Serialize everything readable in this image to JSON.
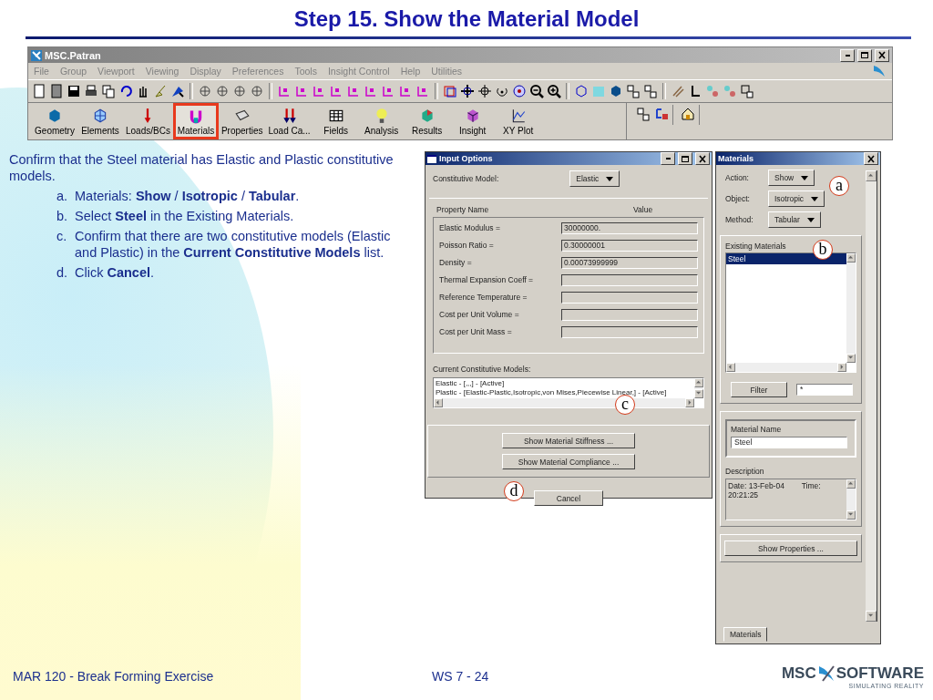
{
  "slide": {
    "title": "Step 15. Show the Material Model",
    "footer_left": "MAR 120 - Break Forming Exercise",
    "footer_center": "WS 7 - 24",
    "logo": {
      "word_1": "MSC",
      "word_2": "SOFTWARE",
      "tagline": "SIMULATING REALITY"
    }
  },
  "patran_window": {
    "title": "MSC.Patran",
    "menu": [
      "File",
      "Group",
      "Viewport",
      "Viewing",
      "Display",
      "Preferences",
      "Tools",
      "Insight Control",
      "Help",
      "Utilities"
    ],
    "apps": [
      {
        "label": "Geometry",
        "selected": false
      },
      {
        "label": "Elements",
        "selected": false
      },
      {
        "label": "Loads/BCs",
        "selected": false
      },
      {
        "label": "Materials",
        "selected": true
      },
      {
        "label": "Properties",
        "selected": false
      },
      {
        "label": "Load Ca...",
        "selected": false
      },
      {
        "label": "Fields",
        "selected": false
      },
      {
        "label": "Analysis",
        "selected": false
      },
      {
        "label": "Results",
        "selected": false
      },
      {
        "label": "Insight",
        "selected": false
      },
      {
        "label": "XY Plot",
        "selected": false
      }
    ]
  },
  "instructions": {
    "intro": "Confirm that the Steel material has Elastic and Plastic constitutive models.",
    "steps": [
      {
        "marker": "a.",
        "text": "Materials: **Show** / **Isotropic** / **Tabular**."
      },
      {
        "marker": "b.",
        "text": "Select **Steel** in the Existing Materials."
      },
      {
        "marker": "c.",
        "text": "Confirm that there are two constitutive models (Elastic and Plastic) in the **Current Constitutive Models** list."
      },
      {
        "marker": "d.",
        "text": "Click **Cancel**."
      }
    ]
  },
  "input_options": {
    "title": "Input Options",
    "constitutive_model_label": "Constitutive Model:",
    "constitutive_model": "Elastic",
    "columns": [
      "Property Name",
      "Value"
    ],
    "properties": [
      {
        "name": "Elastic Modulus =",
        "value": "30000000."
      },
      {
        "name": "Poisson Ratio =",
        "value": "0.30000001"
      },
      {
        "name": "Density =",
        "value": "0.00073999999"
      },
      {
        "name": "Thermal Expansion Coeff ="
      },
      {
        "name": "Reference Temperature ="
      },
      {
        "name": "Cost per Unit Volume ="
      },
      {
        "name": "Cost per Unit Mass ="
      }
    ],
    "current_models_label": "Current Constitutive Models:",
    "current_models": [
      "Elastic - [,,,] - [Active]",
      "Plastic - [Elastic-Plastic,Isotropic,von Mises,Piecewise Linear,] - [Active]"
    ],
    "buttons": [
      "Show Material Stiffness ...",
      "Show Material Compliance ..."
    ],
    "cancel": "Cancel"
  },
  "materials_panel": {
    "title": "Materials",
    "fields": [
      {
        "label": "Action:",
        "value": "Show"
      },
      {
        "label": "Object:",
        "value": "Isotropic"
      },
      {
        "label": "Method:",
        "value": "Tabular"
      }
    ],
    "existing_label": "Existing Materials",
    "materials": [
      {
        "name": "Steel",
        "selected": true
      }
    ],
    "filter_button": "Filter",
    "filter_value": "*",
    "material_name_label": "Material Name",
    "material_name": "Steel",
    "description_label": "Description",
    "description_lines": [
      "Date: 13-Feb-04        Time:",
      "20:21:25"
    ],
    "show_properties": "Show Properties ...",
    "tab": "Materials"
  },
  "callouts": [
    {
      "label": "a"
    },
    {
      "label": "b"
    },
    {
      "label": "c"
    },
    {
      "label": "d"
    }
  ]
}
